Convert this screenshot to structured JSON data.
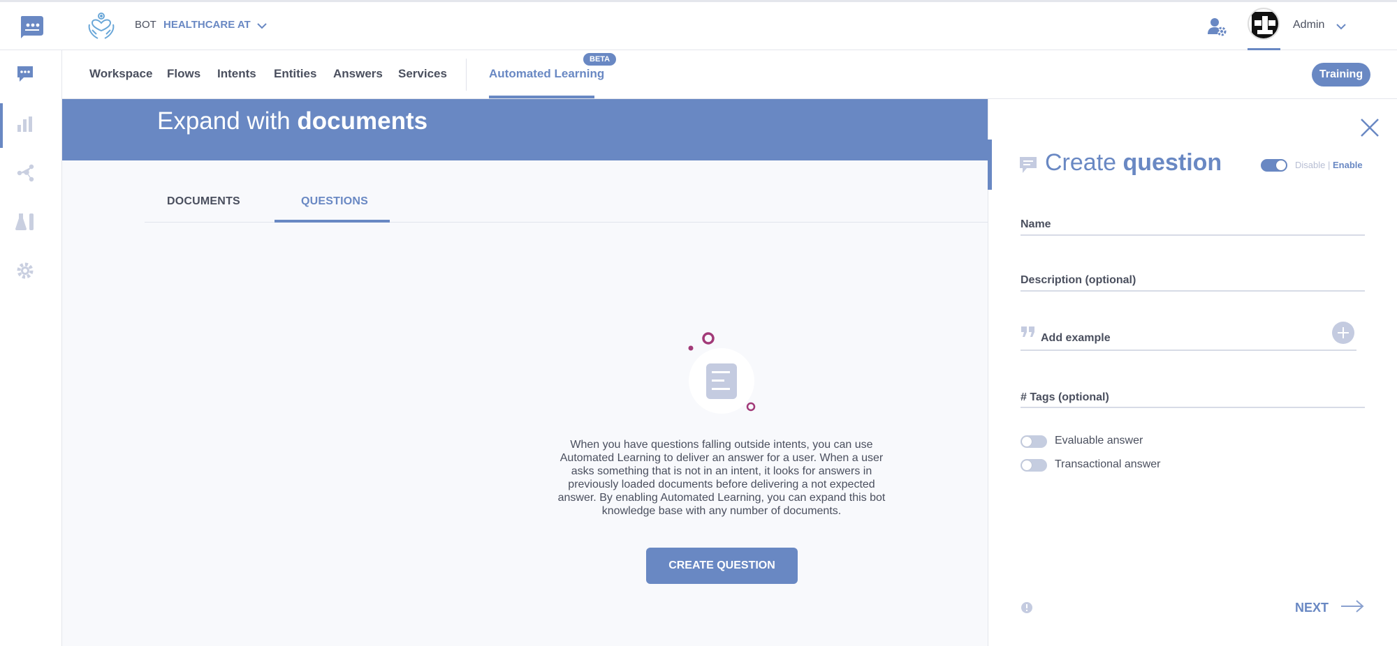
{
  "header": {
    "bot_prefix": "BOT",
    "bot_name": "HEALTHCARE AT",
    "user_name": "Admin"
  },
  "nav": {
    "items": [
      "Workspace",
      "Flows",
      "Intents",
      "Entities",
      "Answers",
      "Services"
    ],
    "active_item": "Automated Learning",
    "beta_badge": "BETA",
    "training_button": "Training"
  },
  "banner": {
    "title_light": "Expand with",
    "title_bold": "documents"
  },
  "tabs": {
    "documents": "DOCUMENTS",
    "questions": "QUESTIONS"
  },
  "empty_state": {
    "message": "When you have questions falling outside intents, you can use Automated Learning to deliver an answer for a user. When a user asks something that is not in an intent, it looks for answers in previously loaded documents before delivering a not expected answer. By enabling Automated Learning, you can expand this bot knowledge base with any number of documents.",
    "cta": "CREATE QUESTION"
  },
  "panel": {
    "title_light": "Create",
    "title_bold": "question",
    "toggle_disable": "Disable",
    "toggle_separator": "|",
    "toggle_enable": "Enable",
    "name_label": "Name",
    "description_label": "Description (optional)",
    "example_label": "Add example",
    "tags_label": "# Tags (optional)",
    "evaluable_label": "Evaluable answer",
    "transactional_label": "Transactional answer",
    "next_label": "NEXT"
  },
  "colors": {
    "accent": "#6988c3",
    "text": "#4a4f5e",
    "decor": "#a23a78"
  }
}
